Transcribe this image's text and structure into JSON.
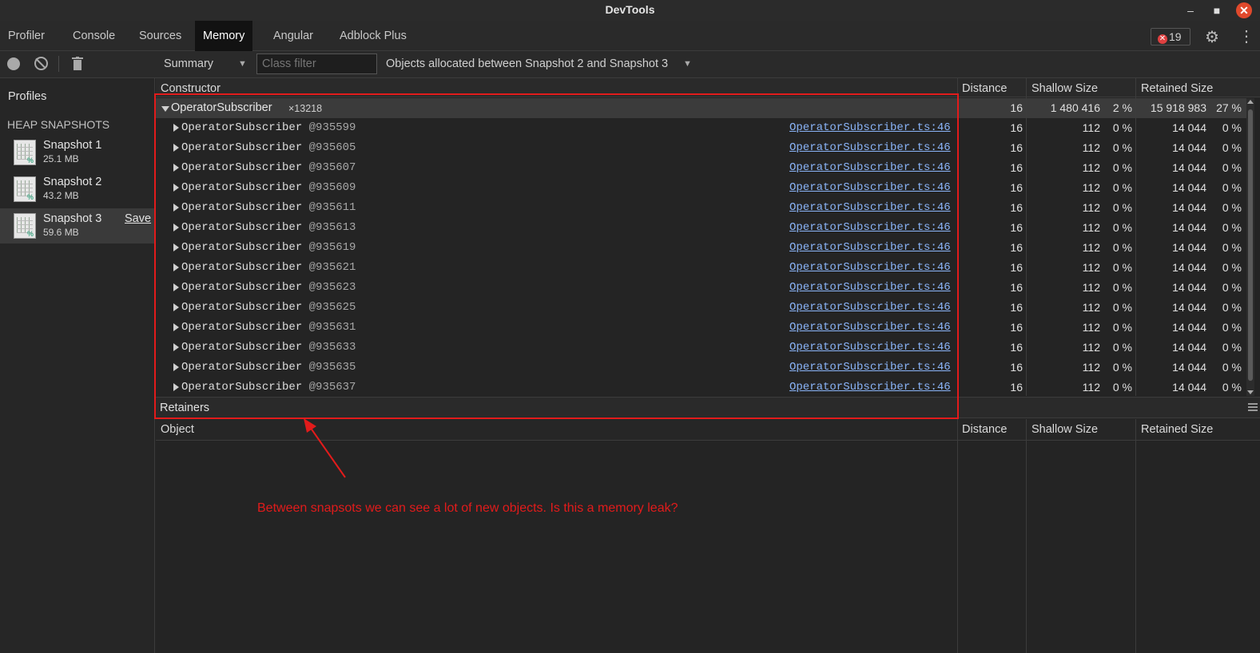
{
  "window": {
    "title": "DevTools"
  },
  "tabs": [
    {
      "label": "Profiler"
    },
    {
      "label": "Console"
    },
    {
      "label": "Sources"
    },
    {
      "label": "Memory"
    },
    {
      "label": "Angular"
    },
    {
      "label": "Adblock Plus"
    }
  ],
  "active_tab": "Memory",
  "error_count": "19",
  "toolbar": {
    "view_mode": "Summary",
    "class_filter_placeholder": "Class filter",
    "range": "Objects allocated between Snapshot 2 and Snapshot 3"
  },
  "sidebar": {
    "title": "Profiles",
    "section": "HEAP SNAPSHOTS",
    "snapshots": [
      {
        "name": "Snapshot 1",
        "size": "25.1 MB"
      },
      {
        "name": "Snapshot 2",
        "size": "43.2 MB"
      },
      {
        "name": "Snapshot 3",
        "size": "59.6 MB",
        "action": "Save"
      }
    ]
  },
  "grid": {
    "columns": {
      "constructor": "Constructor",
      "distance": "Distance",
      "shallow": "Shallow Size",
      "retained": "Retained Size"
    },
    "group": {
      "name": "OperatorSubscriber",
      "count": "×13218",
      "distance": "16",
      "shallow": "1 480 416",
      "shallow_pct": "2 %",
      "retained": "15 918 983",
      "retained_pct": "27 %"
    },
    "rows": [
      {
        "name": "OperatorSubscriber",
        "id": "@935599",
        "link": "OperatorSubscriber.ts:46",
        "distance": "16",
        "shallow": "112",
        "shallow_pct": "0 %",
        "retained": "14 044",
        "retained_pct": "0 %"
      },
      {
        "name": "OperatorSubscriber",
        "id": "@935605",
        "link": "OperatorSubscriber.ts:46",
        "distance": "16",
        "shallow": "112",
        "shallow_pct": "0 %",
        "retained": "14 044",
        "retained_pct": "0 %"
      },
      {
        "name": "OperatorSubscriber",
        "id": "@935607",
        "link": "OperatorSubscriber.ts:46",
        "distance": "16",
        "shallow": "112",
        "shallow_pct": "0 %",
        "retained": "14 044",
        "retained_pct": "0 %"
      },
      {
        "name": "OperatorSubscriber",
        "id": "@935609",
        "link": "OperatorSubscriber.ts:46",
        "distance": "16",
        "shallow": "112",
        "shallow_pct": "0 %",
        "retained": "14 044",
        "retained_pct": "0 %"
      },
      {
        "name": "OperatorSubscriber",
        "id": "@935611",
        "link": "OperatorSubscriber.ts:46",
        "distance": "16",
        "shallow": "112",
        "shallow_pct": "0 %",
        "retained": "14 044",
        "retained_pct": "0 %"
      },
      {
        "name": "OperatorSubscriber",
        "id": "@935613",
        "link": "OperatorSubscriber.ts:46",
        "distance": "16",
        "shallow": "112",
        "shallow_pct": "0 %",
        "retained": "14 044",
        "retained_pct": "0 %"
      },
      {
        "name": "OperatorSubscriber",
        "id": "@935619",
        "link": "OperatorSubscriber.ts:46",
        "distance": "16",
        "shallow": "112",
        "shallow_pct": "0 %",
        "retained": "14 044",
        "retained_pct": "0 %"
      },
      {
        "name": "OperatorSubscriber",
        "id": "@935621",
        "link": "OperatorSubscriber.ts:46",
        "distance": "16",
        "shallow": "112",
        "shallow_pct": "0 %",
        "retained": "14 044",
        "retained_pct": "0 %"
      },
      {
        "name": "OperatorSubscriber",
        "id": "@935623",
        "link": "OperatorSubscriber.ts:46",
        "distance": "16",
        "shallow": "112",
        "shallow_pct": "0 %",
        "retained": "14 044",
        "retained_pct": "0 %"
      },
      {
        "name": "OperatorSubscriber",
        "id": "@935625",
        "link": "OperatorSubscriber.ts:46",
        "distance": "16",
        "shallow": "112",
        "shallow_pct": "0 %",
        "retained": "14 044",
        "retained_pct": "0 %"
      },
      {
        "name": "OperatorSubscriber",
        "id": "@935631",
        "link": "OperatorSubscriber.ts:46",
        "distance": "16",
        "shallow": "112",
        "shallow_pct": "0 %",
        "retained": "14 044",
        "retained_pct": "0 %"
      },
      {
        "name": "OperatorSubscriber",
        "id": "@935633",
        "link": "OperatorSubscriber.ts:46",
        "distance": "16",
        "shallow": "112",
        "shallow_pct": "0 %",
        "retained": "14 044",
        "retained_pct": "0 %"
      },
      {
        "name": "OperatorSubscriber",
        "id": "@935635",
        "link": "OperatorSubscriber.ts:46",
        "distance": "16",
        "shallow": "112",
        "shallow_pct": "0 %",
        "retained": "14 044",
        "retained_pct": "0 %"
      },
      {
        "name": "OperatorSubscriber",
        "id": "@935637",
        "link": "OperatorSubscriber.ts:46",
        "distance": "16",
        "shallow": "112",
        "shallow_pct": "0 %",
        "retained": "14 044",
        "retained_pct": "0 %"
      }
    ]
  },
  "retainers": {
    "title": "Retainers",
    "columns": {
      "object": "Object",
      "distance": "Distance",
      "shallow": "Shallow Size",
      "retained": "Retained Size"
    }
  },
  "annotation": {
    "text": "Between snapsots we can see a lot of  new objects. Is this a memory leak?",
    "color": "#e21b1b"
  },
  "colors": {
    "link": "#8ab4f8",
    "active_tab_bg": "#121212",
    "close_button": "#e0492c"
  }
}
